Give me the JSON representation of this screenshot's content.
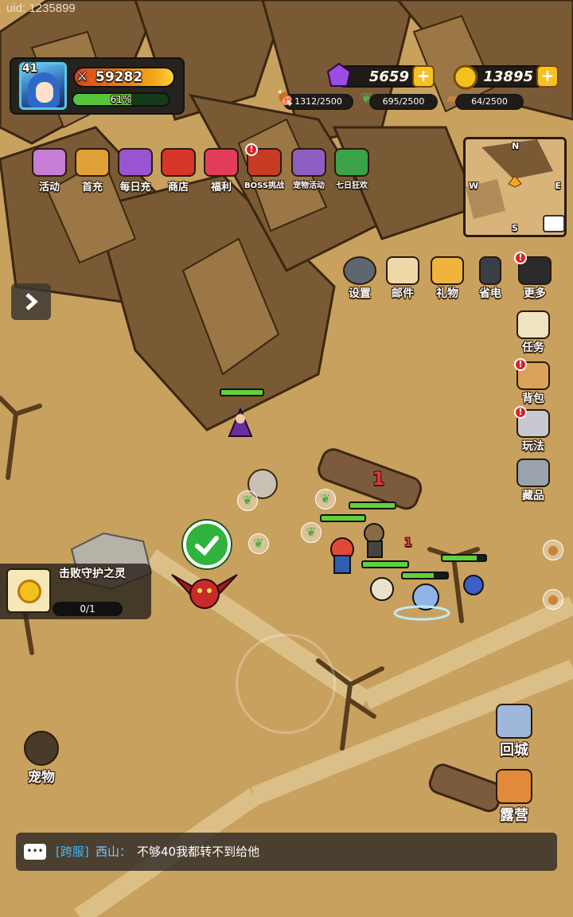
{
  "uid": "uid: 1235899",
  "player": {
    "level": "41",
    "power": "59282",
    "exp_text": "61%",
    "exp_fraction": 0.61
  },
  "currencies": {
    "gems": "5659",
    "gold": "13895",
    "food": "1312/2500",
    "herb": "695/2500",
    "wood": "64/2500"
  },
  "top_menu": [
    {
      "label": "活动",
      "icon": "event-chest-icon",
      "color": "#c77dd6"
    },
    {
      "label": "首充",
      "icon": "king-icon",
      "color": "#e0a03a"
    },
    {
      "label": "每日充",
      "icon": "daily-chest-icon",
      "color": "#9a54d1"
    },
    {
      "label": "商店",
      "icon": "shop-icon",
      "color": "#d7362b"
    },
    {
      "label": "福利",
      "icon": "gift-icon",
      "color": "#e23c5a"
    },
    {
      "label": "BOSS挑战",
      "icon": "boss-icon",
      "color": "#c73a24",
      "badge": "!"
    },
    {
      "label": "宠物活动",
      "icon": "pet-event-icon",
      "color": "#8e5ec2"
    },
    {
      "label": "七日狂欢",
      "icon": "seven-day-icon",
      "color": "#3aa34a"
    }
  ],
  "minimap": {
    "n": "N",
    "w": "W",
    "e": "E",
    "s": "S"
  },
  "utility_menu": [
    {
      "label": "设置",
      "icon": "gear-icon"
    },
    {
      "label": "邮件",
      "icon": "mail-icon"
    },
    {
      "label": "礼物",
      "icon": "gift-house-icon"
    },
    {
      "label": "省电",
      "icon": "battery-icon"
    },
    {
      "label": "更多",
      "icon": "more-grid-icon",
      "badge": "!"
    }
  ],
  "side_menu": [
    {
      "label": "任务",
      "icon": "scroll-icon"
    },
    {
      "label": "背包",
      "icon": "backpack-icon",
      "badge": "!"
    },
    {
      "label": "玩法",
      "icon": "swords-icon",
      "badge": "!"
    },
    {
      "label": "藏品",
      "icon": "trophy-icon"
    }
  ],
  "quest": {
    "title": "击败守护之灵",
    "progress": "0/1"
  },
  "damage_numbers": [
    "1",
    "1"
  ],
  "bottom_left": {
    "label": "宠物"
  },
  "bottom_right": [
    {
      "label": "回城",
      "icon": "portal-icon"
    },
    {
      "label": "露营",
      "icon": "camp-icon"
    }
  ],
  "chat": {
    "channel": "[跨服]",
    "sender": "西山：",
    "message": "不够40我都转不到给他"
  },
  "colors": {
    "hp": "#5fd13c",
    "gem": "#9b4ce3",
    "gold": "#f3c11c"
  }
}
